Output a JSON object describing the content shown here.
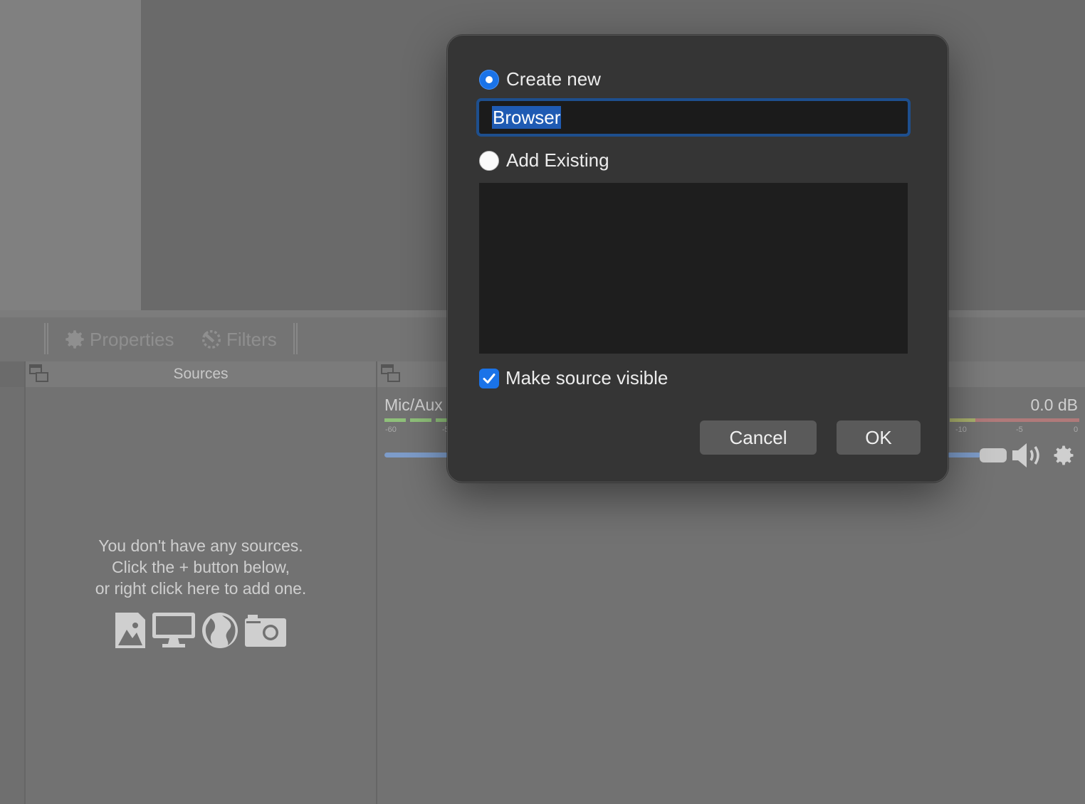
{
  "context_bar": {
    "properties_label": "Properties",
    "filters_label": "Filters"
  },
  "sources_dock": {
    "title": "Sources",
    "empty_line1": "You don't have any sources.",
    "empty_line2": "Click the + button below,",
    "empty_line3": "or right click here to add one."
  },
  "mixer": {
    "channel_name": "Mic/Aux",
    "level_db": "0.0 dB",
    "ticks": [
      "-60",
      "-5",
      "-10",
      "-5",
      "0"
    ]
  },
  "dialog": {
    "create_new_label": "Create new",
    "create_new_selected": true,
    "name_value": "Browser",
    "add_existing_label": "Add Existing",
    "add_existing_selected": false,
    "make_visible_label": "Make source visible",
    "make_visible_checked": true,
    "cancel_label": "Cancel",
    "ok_label": "OK"
  },
  "colors": {
    "accent": "#1a73e8",
    "selection": "#1f5bb3",
    "dialog_bg": "#353535"
  }
}
